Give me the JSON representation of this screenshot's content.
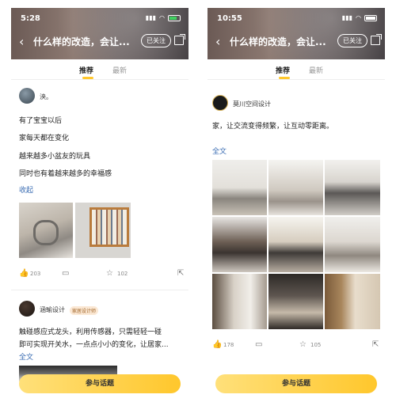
{
  "left": {
    "status": {
      "time": "5:28"
    },
    "header": {
      "title": "什么样的改造，会让...",
      "follow": "已关注"
    },
    "tabs": {
      "recommended": "推荐",
      "latest": "最新"
    },
    "post1": {
      "username": "泱。",
      "lines": [
        "有了宝宝以后",
        "家每天都在变化",
        "越来越多小盆友的玩具",
        "同时也有着越来越多的幸福感"
      ],
      "collapse": "收起",
      "likes": "203",
      "favorites": "102"
    },
    "post2": {
      "username": "涵瑜设计",
      "badge": "家居设计师",
      "lines": [
        "触碰感应式龙头，利用传感器，只需轻轻一碰",
        "即可实现开关水，一点点小小的变化，让居家..."
      ],
      "more": "全文"
    },
    "join_button": "参与话题"
  },
  "right": {
    "status": {
      "time": "10:55"
    },
    "header": {
      "title": "什么样的改造，会让...",
      "follow": "已关注"
    },
    "tabs": {
      "recommended": "推荐",
      "latest": "最新"
    },
    "post": {
      "username": "莫川空间设计",
      "line": "家，让交流变得频繁，让互动零距离。",
      "more": "全文",
      "likes": "178",
      "favorites": "105"
    },
    "join_button": "参与话题"
  },
  "colors": {
    "accent": "#ffc72c",
    "link": "#3b6db3"
  },
  "icons": [
    "back-arrow-icon",
    "share-icon",
    "like-icon",
    "comment-icon",
    "star-icon",
    "external-share-icon",
    "wifi-icon",
    "battery-icon"
  ]
}
